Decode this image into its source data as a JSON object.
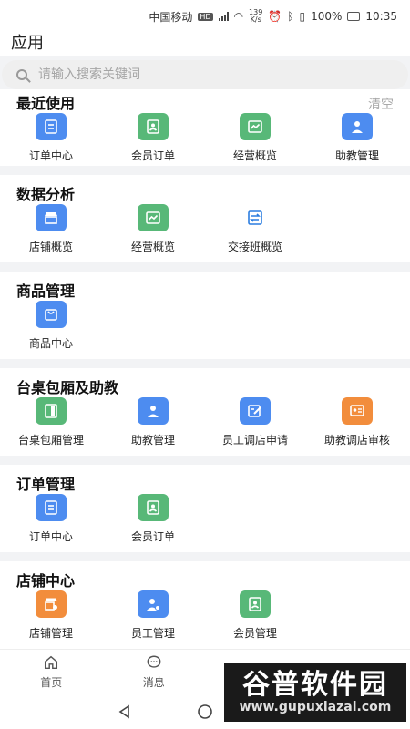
{
  "status_bar": {
    "carrier": "中国移动",
    "hd": "HD",
    "net_speed_value": "139",
    "net_speed_unit": "K/s",
    "battery": "100%",
    "time": "10:35"
  },
  "header": {
    "title": "应用"
  },
  "search": {
    "placeholder": "请输入搜索关键词"
  },
  "sections": [
    {
      "title": "最近使用",
      "clear_label": "清空",
      "items": [
        {
          "label": "订单中心",
          "icon": "order-icon",
          "color": "#4d8cf0"
        },
        {
          "label": "会员订单",
          "icon": "member-icon",
          "color": "#58b878"
        },
        {
          "label": "经营概览",
          "icon": "chart-icon",
          "color": "#58b878"
        },
        {
          "label": "助教管理",
          "icon": "person-icon",
          "color": "#4d8cf0"
        }
      ]
    },
    {
      "title": "数据分析",
      "items": [
        {
          "label": "店铺概览",
          "icon": "store-icon",
          "color": "#4d8cf0"
        },
        {
          "label": "经营概览",
          "icon": "chart-icon",
          "color": "#58b878"
        },
        {
          "label": "交接班概览",
          "icon": "shift-icon",
          "color": "#4d8cf0"
        }
      ]
    },
    {
      "title": "商品管理",
      "items": [
        {
          "label": "商品中心",
          "icon": "bag-icon",
          "color": "#4d8cf0"
        }
      ]
    },
    {
      "title": "台桌包厢及助教",
      "items": [
        {
          "label": "台桌包厢管理",
          "icon": "door-icon",
          "color": "#58b878"
        },
        {
          "label": "助教管理",
          "icon": "person-icon",
          "color": "#4d8cf0"
        },
        {
          "label": "员工调店申请",
          "icon": "edit-icon",
          "color": "#4d8cf0"
        },
        {
          "label": "助教调店审核",
          "icon": "card-icon",
          "color": "#f28d3c"
        }
      ]
    },
    {
      "title": "订单管理",
      "items": [
        {
          "label": "订单中心",
          "icon": "order-icon",
          "color": "#4d8cf0"
        },
        {
          "label": "会员订单",
          "icon": "member-icon",
          "color": "#58b878"
        }
      ]
    },
    {
      "title": "店铺中心",
      "items": [
        {
          "label": "店铺管理",
          "icon": "store-settings-icon",
          "color": "#f28d3c"
        },
        {
          "label": "员工管理",
          "icon": "staff-icon",
          "color": "#4d8cf0"
        },
        {
          "label": "会员管理",
          "icon": "member-icon",
          "color": "#58b878"
        }
      ]
    }
  ],
  "tab_bar": [
    {
      "label": "首页",
      "icon": "home-icon"
    },
    {
      "label": "消息",
      "icon": "message-icon"
    },
    {
      "label": "",
      "icon": "apps-icon"
    },
    {
      "label": "",
      "icon": "profile-icon"
    }
  ],
  "watermark": {
    "title": "谷普软件园",
    "url": "www.gupuxiazai.com"
  }
}
